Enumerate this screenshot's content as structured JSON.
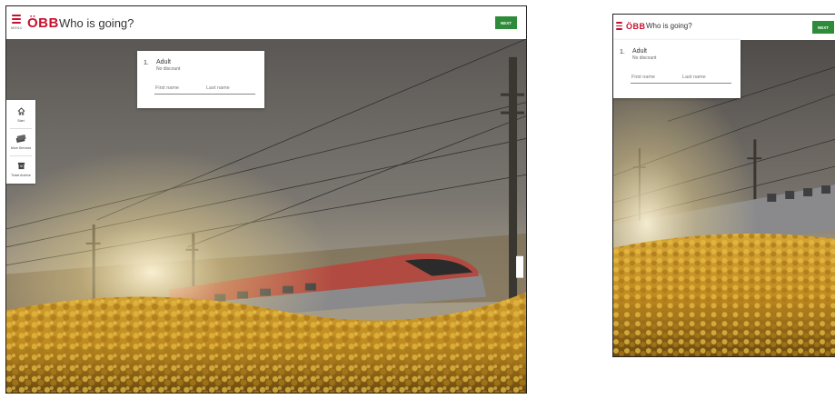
{
  "header": {
    "menu_label": "MENU",
    "logo_text": "ÖBB",
    "title": "Who is going?",
    "next_label": "NEXT"
  },
  "passenger": {
    "number": "1.",
    "type": "Adult",
    "discount": "No discount",
    "first_name_placeholder": "First name",
    "last_name_placeholder": "Last name"
  },
  "sidebar": {
    "items": [
      {
        "label": "Start",
        "icon": "home-icon"
      },
      {
        "label": "More Services",
        "icon": "tickets-icon"
      },
      {
        "label": "Ticket Archive",
        "icon": "archive-box-icon"
      }
    ]
  },
  "colors": {
    "brand_red": "#c8102e",
    "next_green": "#2e8b3a"
  }
}
